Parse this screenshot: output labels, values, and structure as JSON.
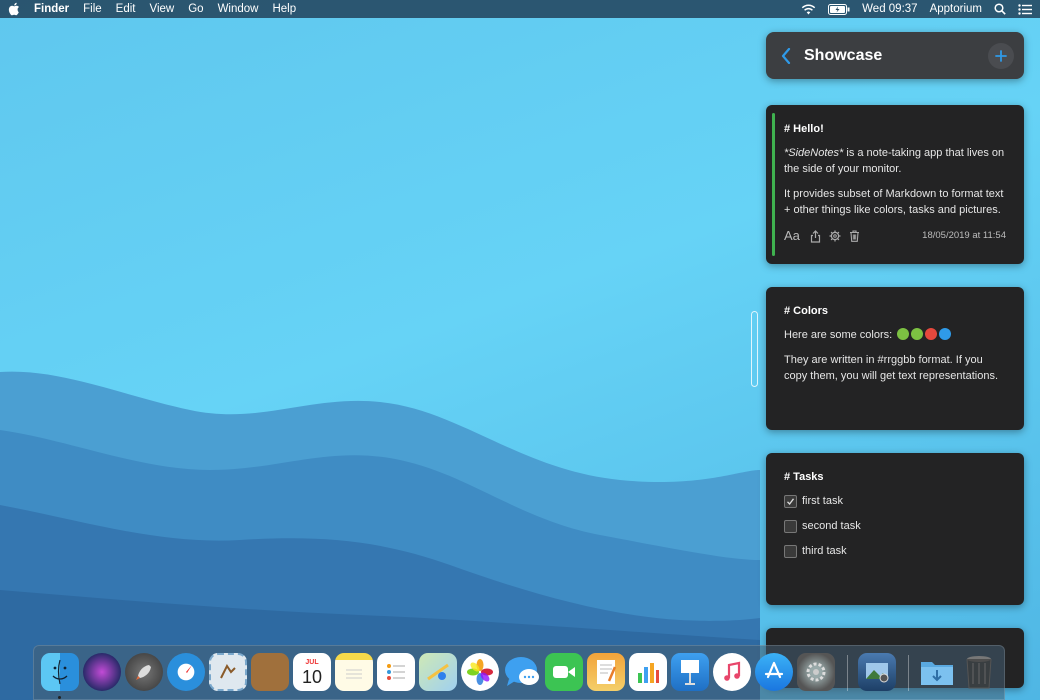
{
  "menubar": {
    "app_name": "Finder",
    "items": [
      "File",
      "Edit",
      "View",
      "Go",
      "Window",
      "Help"
    ],
    "clock": "Wed 09:37",
    "user": "Apptorium"
  },
  "sidenotes": {
    "title": "Showcase",
    "notes": [
      {
        "heading": "# Hello!",
        "p1_em": "*SideNotes*",
        "p1_rest": " is a note-taking app that lives on the side of your monitor.",
        "p2": "It provides subset of Markdown to format text + other things like colors, tasks and pictures.",
        "font_label": "Aa",
        "timestamp": "18/05/2019 at 11:54"
      },
      {
        "heading": "# Colors",
        "p1": "Here are some colors:",
        "colors": [
          "#7cc142",
          "#7cc142",
          "#e5483d",
          "#2f9ae8"
        ],
        "p2": "They are written in #rrggbb format. If you copy them, you will get text representations."
      },
      {
        "heading": "# Tasks",
        "tasks": [
          {
            "label": "first task",
            "done": true
          },
          {
            "label": "second task",
            "done": false
          },
          {
            "label": "third task",
            "done": false
          }
        ]
      }
    ]
  },
  "calendar_icon": {
    "month": "JUL",
    "day": "10"
  },
  "accent_color": "#2f9ae8"
}
